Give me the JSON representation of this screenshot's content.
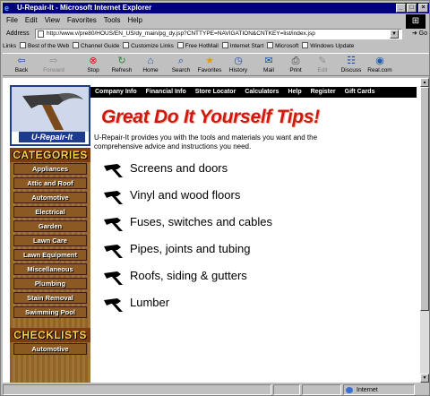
{
  "window": {
    "title": "U-Repair-It - Microsoft Internet Explorer"
  },
  "menu": [
    "File",
    "Edit",
    "View",
    "Favorites",
    "Tools",
    "Help"
  ],
  "address": {
    "label": "Address",
    "url": "http://www.v/pre80/HOUS/EN_US/dy_main/pg_dy.jsp?CNTTYPE=NAVIGATION&CNTKEY=list/index.jsp",
    "go_label": "Go"
  },
  "links": {
    "label": "Links",
    "items": [
      "Best of the Web",
      "Channel Guide",
      "Customize Links",
      "Free HotMail",
      "Internet Start",
      "Microsoft",
      "Windows Update"
    ]
  },
  "toolbar": {
    "back": "Back",
    "forward": "Forward",
    "stop": "Stop",
    "refresh": "Refresh",
    "home": "Home",
    "search": "Search",
    "favorites": "Favorites",
    "history": "History",
    "mail": "Mail",
    "print": "Print",
    "edit": "Edit",
    "discuss": "Discuss",
    "realcom": "Real.com"
  },
  "status": {
    "zone": "Internet"
  },
  "page": {
    "logo_text": "U-Repair-It",
    "nav": [
      "Company Info",
      "Financial Info",
      "Store Locator",
      "Calculators",
      "Help",
      "Register",
      "Gift Cards"
    ],
    "headline": "Great Do It Yourself Tips!",
    "intro": "U-Repair-It provides you with the tools and materials you want and the comprehensive advice and instructions you need.",
    "categories_heading": "CATEGORIES",
    "categories": [
      "Appliances",
      "Attic and Roof",
      "Automotive",
      "Electrical",
      "Garden",
      "Lawn Care",
      "Lawn Equipment",
      "Miscellaneous",
      "Plumbing",
      "Stain Removal",
      "Swimming Pool"
    ],
    "checklists_heading": "CHECKLISTS",
    "checklists": [
      "Automotive"
    ],
    "tips": [
      "Screens and doors",
      "Vinyl and wood floors",
      "Fuses, switches and cables",
      "Pipes, joints and tubing",
      "Roofs, siding & gutters",
      "Lumber"
    ]
  }
}
